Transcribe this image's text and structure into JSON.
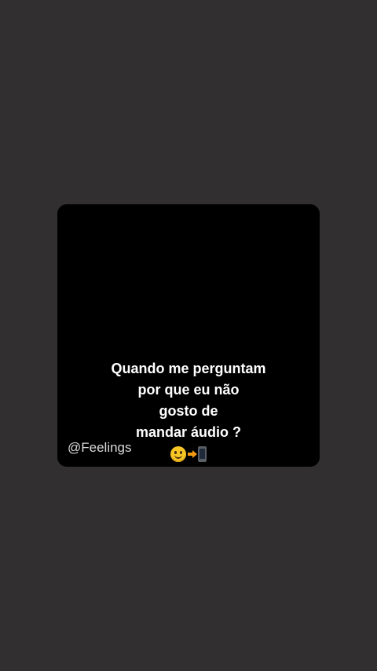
{
  "post": {
    "caption_lines": [
      "Quando me perguntam",
      "por que eu não",
      "gosto de",
      "mandar áudio ?"
    ],
    "emoji_icons": [
      "slightly-smiling-face-icon",
      "arrow-right-icon",
      "mobile-phone-icon"
    ],
    "watermark": "@Feelings"
  },
  "colors": {
    "screen_background": "#322f31",
    "card_background": "#000000",
    "caption_text": "#ffffff",
    "watermark_text": "#d9d9d9"
  }
}
